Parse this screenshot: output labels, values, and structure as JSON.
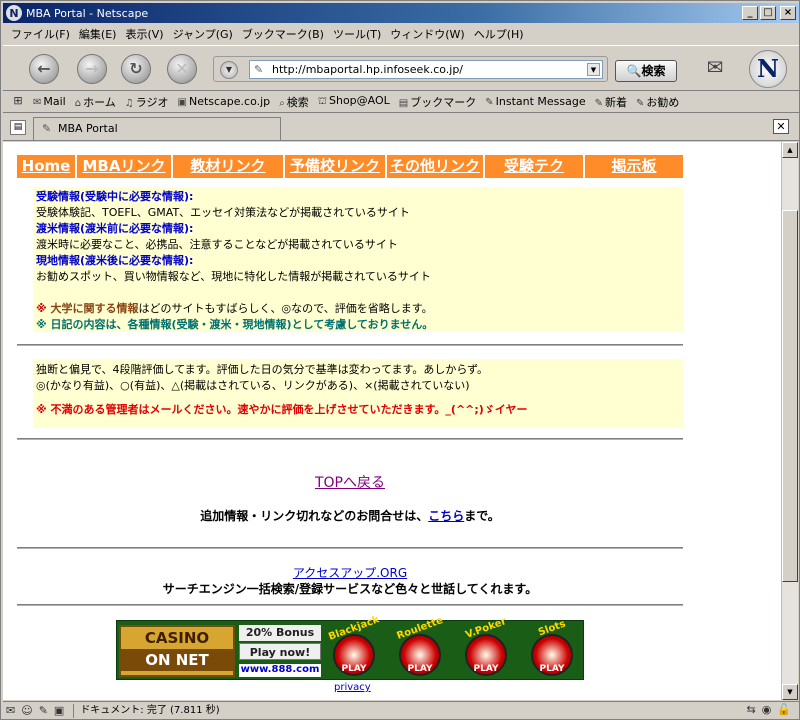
{
  "window": {
    "title": "MBA Portal - Netscape",
    "app_icon": "N"
  },
  "menubar": [
    "ファイル(F)",
    "編集(E)",
    "表示(V)",
    "ジャンプ(G)",
    "ブックマーク(B)",
    "ツール(T)",
    "ウィンドウ(W)",
    "ヘルプ(H)"
  ],
  "navigation": {
    "url": "http://mbaportal.hp.infoseek.co.jp/",
    "search_label": "検索",
    "logo": "N"
  },
  "personal_toolbar": [
    "Mail",
    "ホーム",
    "ラジオ",
    "Netscape.co.jp",
    "検索",
    "Shop@AOL",
    "ブックマーク",
    "Instant Message",
    "新着",
    "お勧め"
  ],
  "tab": {
    "title": "MBA Portal"
  },
  "page": {
    "nav": [
      "Home",
      "MBAリンク",
      "教材リンク",
      "予備校リンク",
      "その他リンク",
      "受験テク",
      "掲示板"
    ],
    "info": {
      "h1": "受験情報(受験中に必要な情報):",
      "t1": "受験体験記、TOEFL、GMAT、エッセイ対策法などが掲載されているサイト",
      "h2": "渡米情報(渡米前に必要な情報):",
      "t2": "渡米時に必要なこと、必携品、注意することなどが掲載されているサイト",
      "h3": "現地情報(渡米後に必要な情報):",
      "t3": "お勧めスポット、買い物情報など、現地に特化した情報が掲載されているサイト",
      "note1_mark": "※",
      "note1_bold": "大学に関する情報",
      "note1_rest": "はどのサイトもすばらしく、◎なので、評価を省略します。",
      "note2": "※ 日記の内容は、各種情報(受験・渡米・現地情報)として考慮しておりません。"
    },
    "rating": {
      "l1": "独断と偏見で、4段階評価してます。評価した日の気分で基準は変わってます。あしからず。",
      "l2": "◎(かなり有益)、○(有益)、△(掲載はされている、リンクがある)、×(掲載されていない)",
      "warn": "※ 不満のある管理者はメールください。速やかに評価を上げさせていただきます。_(^^;)ゞイヤー"
    },
    "top_link": "TOPへ戻る",
    "contact_pre": "追加情報・リンク切れなどのお問合せは、",
    "contact_link": "こちら",
    "contact_post": "まで。",
    "access_link": "アクセスアップ.ORG",
    "access_desc": "サーチエンジン一括検索/登録サービスなど色々と世話してくれます。",
    "banner": {
      "logo_top": "CASINO",
      "logo_bottom": "ON NET",
      "bonus": "20% Bonus",
      "play": "Play now!",
      "url": "www.888.com",
      "games": [
        "Blackjack",
        "Roulette",
        "V.Poker",
        "Slots"
      ],
      "game_cta": "PLAY"
    },
    "privacy": "privacy"
  },
  "status": {
    "text": "ドキュメント: 完了 (7.811 秒)"
  },
  "colors": {
    "nav_bg": "#ff8c28",
    "info_bg": "#ffffd2",
    "heading_blue": "#0000c8",
    "warn_red": "#e00000",
    "teal": "#007070"
  }
}
